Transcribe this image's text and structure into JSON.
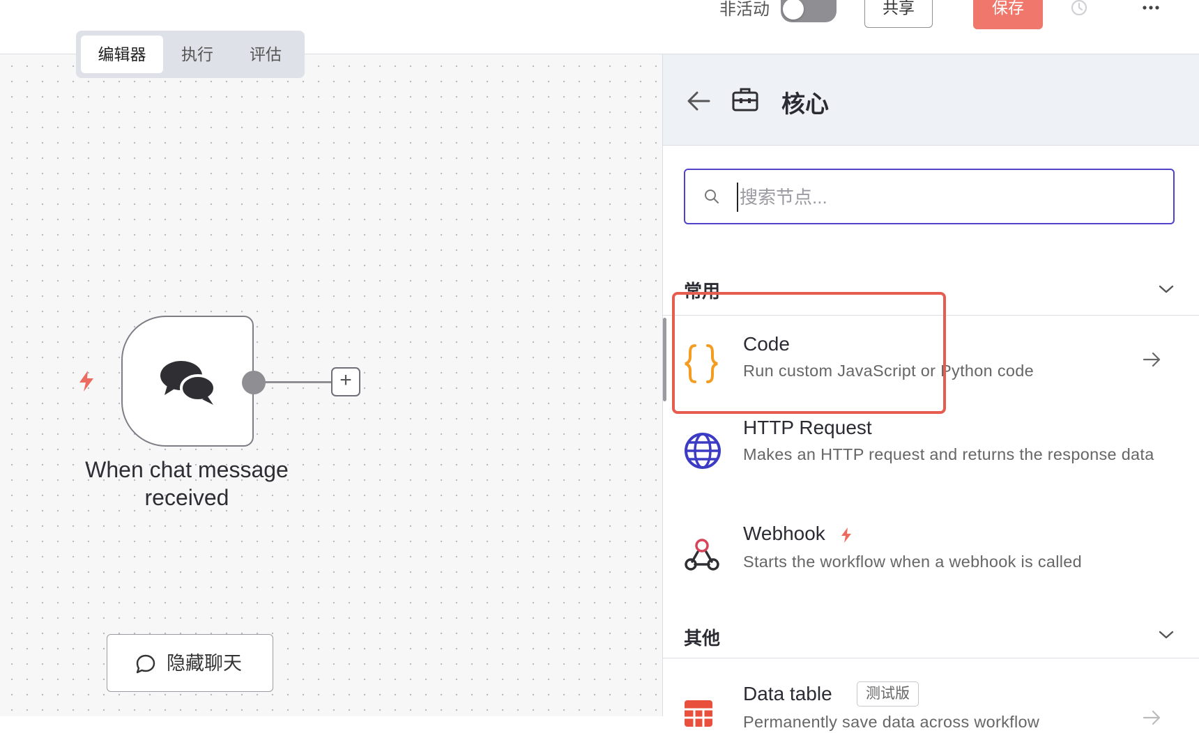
{
  "header": {
    "status_label": "非活动",
    "share_label": "共享",
    "save_label": "保存"
  },
  "tabs": [
    {
      "label": "编辑器",
      "active": true
    },
    {
      "label": "执行",
      "active": false
    },
    {
      "label": "评估",
      "active": false
    }
  ],
  "canvas": {
    "node_label": "When chat message received",
    "hide_chat_label": "隐藏聊天"
  },
  "panel": {
    "title": "核心",
    "search_placeholder": "搜索节点...",
    "sections": [
      {
        "label": "常用",
        "items": [
          {
            "title": "Code",
            "desc": "Run custom JavaScript or Python code",
            "icon": "code-braces-icon"
          },
          {
            "title": "HTTP Request",
            "desc": "Makes an HTTP request and returns the response data",
            "icon": "globe-icon"
          },
          {
            "title": "Webhook",
            "desc": "Starts the workflow when a webhook is called",
            "icon": "webhook-icon"
          }
        ]
      },
      {
        "label": "其他",
        "items": [
          {
            "title": "Data table",
            "badge": "测试版",
            "desc": "Permanently save data across workflow",
            "icon": "table-icon"
          }
        ]
      }
    ]
  },
  "colors": {
    "accent": "#5043c9",
    "save": "#f0776b",
    "highlight": "#e65c4f",
    "code_icon": "#f39c1f",
    "globe_icon": "#3c3bc4",
    "table_icon": "#e8503d"
  }
}
